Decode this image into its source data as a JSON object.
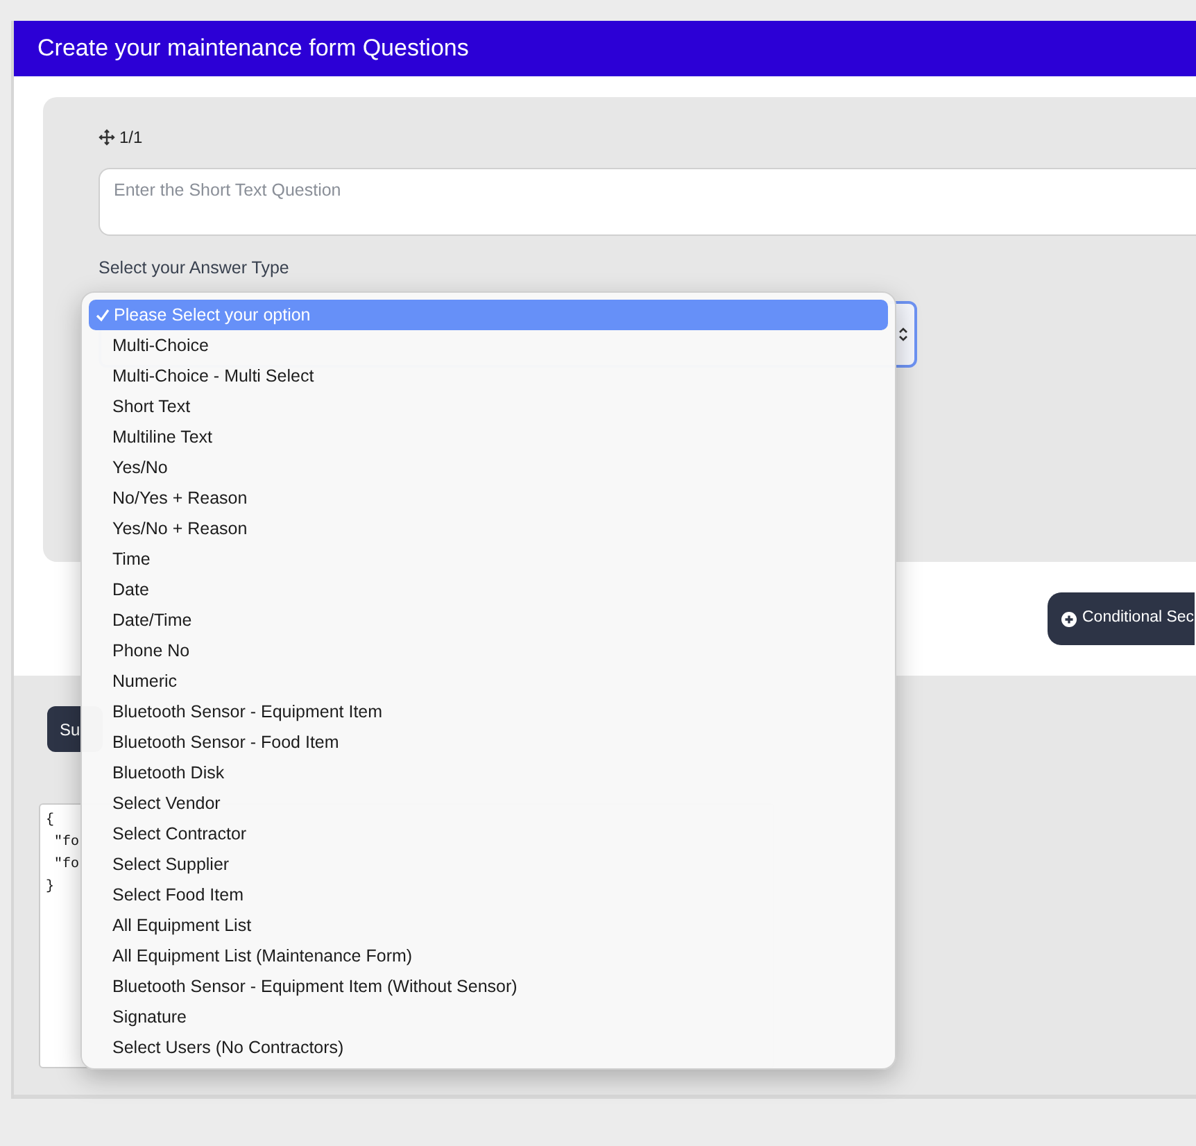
{
  "header": {
    "title": "Create your maintenance form Questions"
  },
  "question": {
    "counter": "1/1",
    "placeholder": "Enter the Short Text Question",
    "answer_type_label": "Select your Answer Type"
  },
  "answer_type_menu": {
    "options": [
      {
        "label": "Please Select your option",
        "selected": true
      },
      {
        "label": "Multi-Choice",
        "selected": false
      },
      {
        "label": "Multi-Choice - Multi Select",
        "selected": false
      },
      {
        "label": "Short Text",
        "selected": false
      },
      {
        "label": "Multiline Text",
        "selected": false
      },
      {
        "label": "Yes/No",
        "selected": false
      },
      {
        "label": "No/Yes + Reason",
        "selected": false
      },
      {
        "label": "Yes/No + Reason",
        "selected": false
      },
      {
        "label": "Time",
        "selected": false
      },
      {
        "label": "Date",
        "selected": false
      },
      {
        "label": "Date/Time",
        "selected": false
      },
      {
        "label": "Phone No",
        "selected": false
      },
      {
        "label": "Numeric",
        "selected": false
      },
      {
        "label": "Bluetooth Sensor - Equipment Item",
        "selected": false
      },
      {
        "label": "Bluetooth Sensor - Food Item",
        "selected": false
      },
      {
        "label": "Bluetooth Disk",
        "selected": false
      },
      {
        "label": "Select Vendor",
        "selected": false
      },
      {
        "label": "Select Contractor",
        "selected": false
      },
      {
        "label": "Select Supplier",
        "selected": false
      },
      {
        "label": "Select Food Item",
        "selected": false
      },
      {
        "label": "All Equipment List",
        "selected": false
      },
      {
        "label": "All Equipment List (Maintenance Form)",
        "selected": false
      },
      {
        "label": "Bluetooth Sensor - Equipment Item (Without Sensor)",
        "selected": false
      },
      {
        "label": "Signature",
        "selected": false
      },
      {
        "label": "Select Users (No Contractors)",
        "selected": false
      }
    ]
  },
  "conditional_button": {
    "label": "Conditional Sec"
  },
  "submit_button": {
    "label": "Su"
  },
  "json_preview": {
    "lines": [
      "{",
      " \"fo",
      " \"fo",
      "}"
    ]
  }
}
